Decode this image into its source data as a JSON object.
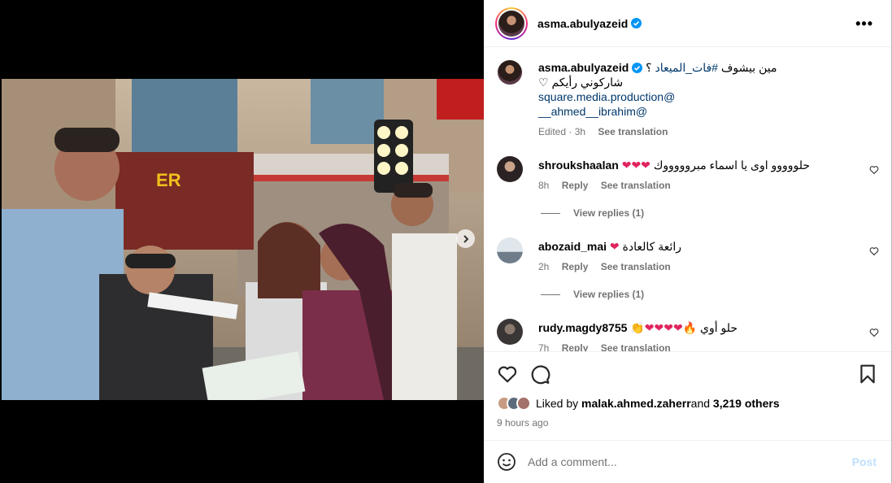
{
  "post": {
    "username": "asma.abulyazeid",
    "caption_line1_prefix": "مين بيشوف ",
    "caption_hashtag": "#فات_الميعاد",
    "caption_line1_suffix": " ؟",
    "caption_line2": "شاركوني رأيكم ♡",
    "mention1": "square.media.production@",
    "mention2": "__ahmed__ibrahim@",
    "edited": "Edited · 3h",
    "see_translation": "See translation"
  },
  "comments": [
    {
      "username": "shroukshaalan",
      "text": "حلووووو اوى يا اسماء مبروووووك",
      "emoji": "❤❤❤",
      "time": "8h",
      "reply": "Reply",
      "see_translation": "See translation",
      "view_replies": "View replies (1)"
    },
    {
      "username": "abozaid_mai",
      "text": "رائعة كالعادة",
      "emoji": "❤",
      "time": "2h",
      "reply": "Reply",
      "see_translation": "See translation",
      "view_replies": "View replies (1)"
    },
    {
      "username": "rudy.magdy8755",
      "text": "حلو أوي",
      "emoji": "👏❤❤❤❤🔥",
      "time": "7h",
      "reply": "Reply",
      "see_translation": "See translation"
    }
  ],
  "likes": {
    "prefix": "Liked by ",
    "user": "malak.ahmed.zaherr",
    "middle": " and ",
    "count": "3,219 others"
  },
  "time_ago": "9 hours ago",
  "add_comment": {
    "placeholder": "Add a comment...",
    "post_label": "Post"
  },
  "colors": {
    "accent": "#0095f6",
    "link": "#00376b",
    "secondary_text": "#737373",
    "heart_red": "#e0245e"
  }
}
